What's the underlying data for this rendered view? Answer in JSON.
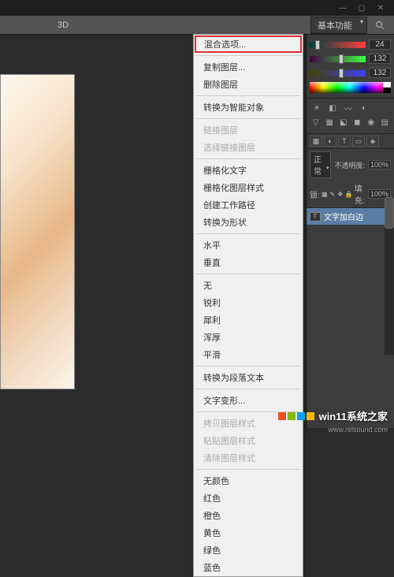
{
  "window": {
    "min": "—",
    "max": "▢",
    "close": "✕"
  },
  "menu": {
    "threeD": "3D",
    "preset": "基本功能"
  },
  "ctx": {
    "blend_options": "混合选项...",
    "copy_layer": "复制图层...",
    "delete_layer": "删除图层",
    "to_smart": "转换为智能对象",
    "link_layer": "链接图层",
    "select_linked": "选择链接图层",
    "rasterize_text": "栅格化文字",
    "rasterize_style": "栅格化图层样式",
    "create_path": "创建工作路径",
    "to_shape": "转换为形状",
    "horizontal": "水平",
    "vertical": "垂直",
    "none": "无",
    "sharp": "锐利",
    "crisp": "犀利",
    "strong": "浑厚",
    "smooth": "平滑",
    "to_paragraph": "转换为段落文本",
    "warp_text": "文字变形...",
    "copy_style": "拷贝图层样式",
    "paste_style": "粘贴图层样式",
    "clear_style": "清除图层样式",
    "no_color": "无颜色",
    "red": "红色",
    "orange": "橙色",
    "yellow": "黄色",
    "green": "绿色",
    "blue": "蓝色"
  },
  "colors": {
    "r": "24",
    "g": "132",
    "b": "132"
  },
  "layers": {
    "mode": "正常",
    "opacity_label": "不透明度:",
    "opacity": "100%",
    "lock_label": "锁:",
    "fill_label": "填充:",
    "fill": "100%",
    "name": "文字加白边"
  },
  "wm": {
    "main": "win11系统之家",
    "sub": "www.relsound.com"
  }
}
